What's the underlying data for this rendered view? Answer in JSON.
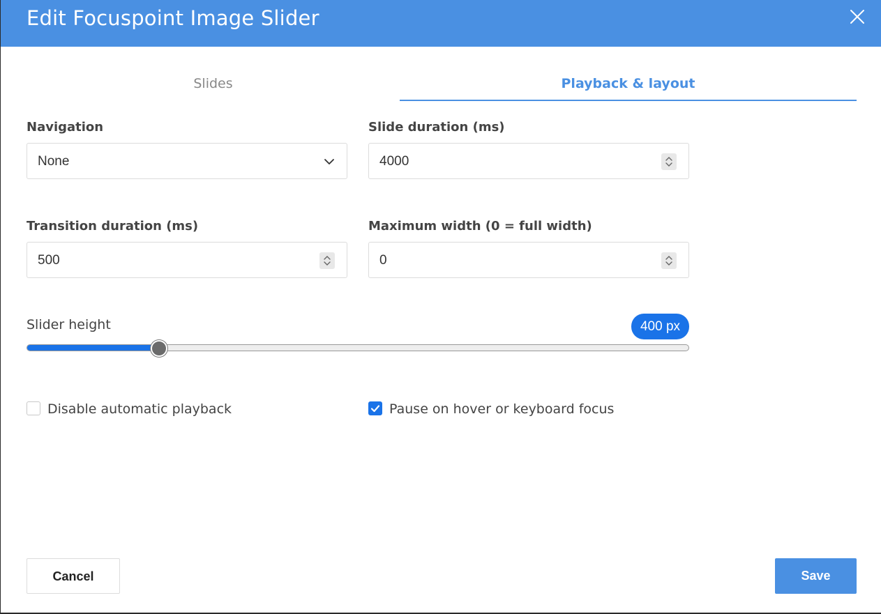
{
  "dialog": {
    "title": "Edit Focuspoint Image Slider",
    "accent_color": "#4a90e2"
  },
  "tabs": [
    {
      "label": "Slides",
      "active": false
    },
    {
      "label": "Playback & layout",
      "active": true
    }
  ],
  "form": {
    "navigation": {
      "label": "Navigation",
      "value": "None"
    },
    "slide_duration": {
      "label": "Slide duration (ms)",
      "value": "4000"
    },
    "transition_duration": {
      "label": "Transition duration (ms)",
      "value": "500"
    },
    "max_width": {
      "label": "Maximum width (0 = full width)",
      "value": "0"
    },
    "slider_height": {
      "label": "Slider height",
      "value_text": "400 px",
      "fraction": 0.2
    },
    "disable_autoplay": {
      "label": "Disable automatic playback",
      "checked": false
    },
    "pause_on_hover": {
      "label": "Pause on hover or keyboard focus",
      "checked": true
    }
  },
  "footer": {
    "cancel_label": "Cancel",
    "save_label": "Save"
  },
  "icons": {
    "close": "close-icon",
    "dropdown": "chevron-down-icon",
    "spinner": "spinner-arrows-icon",
    "check": "checkmark-icon"
  }
}
